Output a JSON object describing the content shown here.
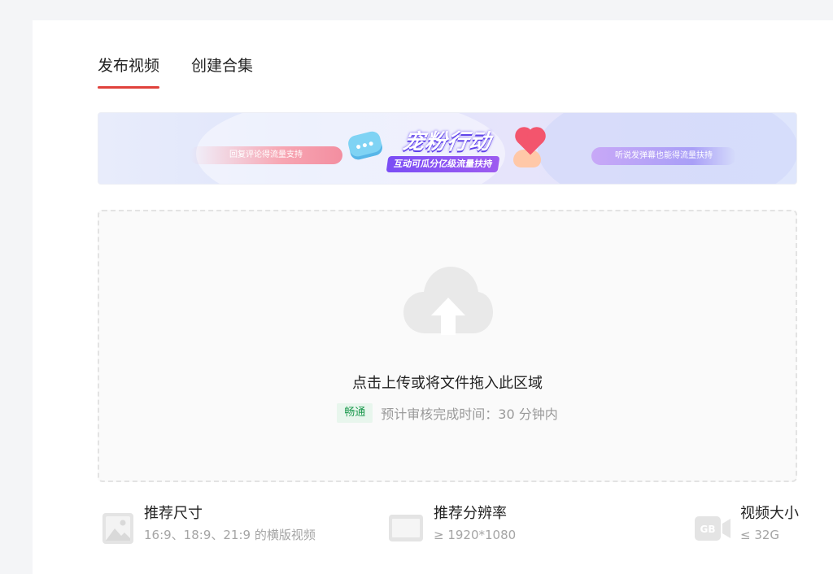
{
  "tabs": [
    {
      "label": "发布视频",
      "active": true
    },
    {
      "label": "创建合集",
      "active": false
    }
  ],
  "banner": {
    "title": "宠粉行动",
    "subtitle": "互动可瓜分亿级流量扶持",
    "left_tag": "回复评论得流量支持",
    "right_tag": "听说发弹幕也能得流量扶持"
  },
  "upload": {
    "icon": "cloud-upload-icon",
    "prompt": "点击上传或将文件拖入此区域",
    "status_badge": "畅通",
    "eta": "预计审核完成时间：30 分钟内"
  },
  "specs": [
    {
      "icon": "image-icon",
      "title": "推荐尺寸",
      "desc": "16:9、18:9、21:9 的横版视频"
    },
    {
      "icon": "monitor-icon",
      "title": "推荐分辨率",
      "desc": "≥ 1920*1080"
    },
    {
      "icon": "gb-video-icon",
      "icon_text": "GB",
      "title": "视频大小",
      "desc": "≤ 32G"
    }
  ],
  "colors": {
    "accent": "#e0413b",
    "badge_text": "#1f9a50",
    "badge_bg": "#e8f6ed"
  }
}
